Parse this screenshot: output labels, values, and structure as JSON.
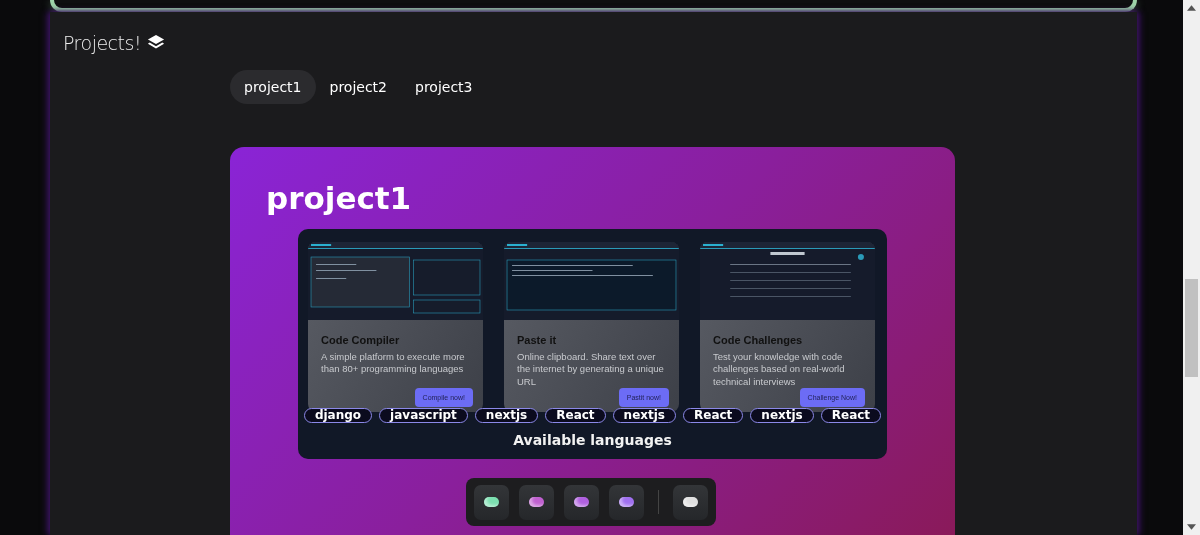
{
  "section": {
    "title": "Projects!"
  },
  "tabs": [
    {
      "label": "project1",
      "selected": true
    },
    {
      "label": "project2",
      "selected": false
    },
    {
      "label": "project3",
      "selected": false
    }
  ],
  "project": {
    "title": "project1",
    "cards": [
      {
        "title": "Code Compiler",
        "description": "A simple platform to execute more than 80+ programming languages",
        "button": "Compile now!"
      },
      {
        "title": "Paste it",
        "description": "Online clipboard. Share text over the internet by generating a unique URL",
        "button": "Pastit now!"
      },
      {
        "title": "Code Challenges",
        "description": "Test your knowledge with code challenges based on real-world technical interviews",
        "button": "Challenge Now!"
      }
    ],
    "tags": [
      "django",
      "javascript",
      "nextjs",
      "React",
      "nextjs",
      "React",
      "nextjs",
      "React"
    ],
    "languages_heading": "Available languages"
  },
  "dock": {
    "main": [
      {
        "color": "#7be0b0"
      },
      {
        "color": "#c060d0"
      },
      {
        "color": "#b060e0"
      },
      {
        "color": "#a070f0"
      }
    ],
    "extra": [
      {
        "color": "#e0e0e0"
      }
    ]
  }
}
